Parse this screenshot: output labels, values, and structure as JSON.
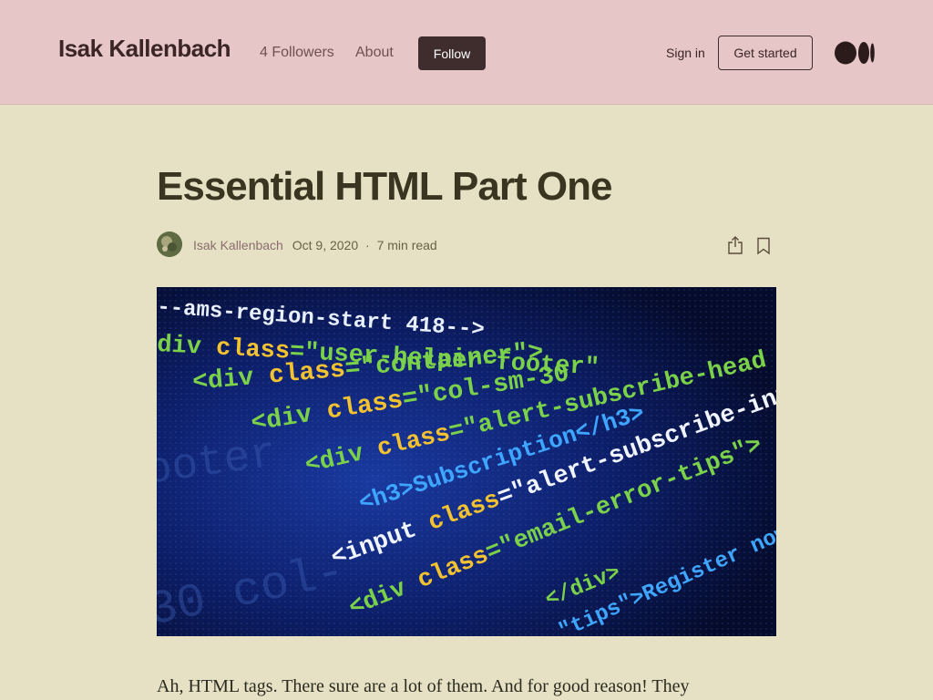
{
  "header": {
    "brand": "Isak Kallenbach",
    "followers": "4 Followers",
    "about": "About",
    "follow": "Follow",
    "sign_in": "Sign in",
    "get_started": "Get started"
  },
  "article": {
    "title": "Essential HTML Part One",
    "author": "Isak Kallenbach",
    "date": "Oct 9, 2020",
    "separator": "·",
    "read_time": "7 min read",
    "intro": "Ah, HTML tags. There sure are a lot of them. And for good reason! They"
  },
  "hero_code_lines": [
    {
      "text": "--ams-region-start 418-->",
      "color": "#e8f0ff"
    },
    {
      "text": "div class=\"user-helper-footer\"",
      "color": "#7bd24a"
    },
    {
      "text": "<div class=\"container\">",
      "color": "#7bd24a"
    },
    {
      "text": "<div class=\"col-sm-30",
      "color": "#7bd24a"
    },
    {
      "text": "<div class=\"alert-subscribe-head",
      "color": "#7bd24a"
    },
    {
      "text": "<h3>Subscription</h3>",
      "color": "#3fa6ff"
    },
    {
      "text": "<input class=\"alert-subscribe-input",
      "color": "#f0f4ff"
    },
    {
      "text": "<div class=\"email-error-tips\">",
      "color": "#7bd24a"
    },
    {
      "text": "</div>",
      "color": "#7bd24a"
    },
    {
      "text": "\"tips\">Register now to get",
      "color": "#3fa6ff"
    }
  ],
  "hero_background_text": [
    "ooter",
    "30 col-"
  ],
  "colors": {
    "header_bg": "#e6c6c6",
    "page_bg": "#e6e1c4",
    "follow_bg": "#3f2c2c",
    "code_bg": "#0a1645",
    "attr_yellow": "#f2c230"
  },
  "icons": [
    "medium-logo-icon",
    "share-icon",
    "bookmark-icon"
  ]
}
